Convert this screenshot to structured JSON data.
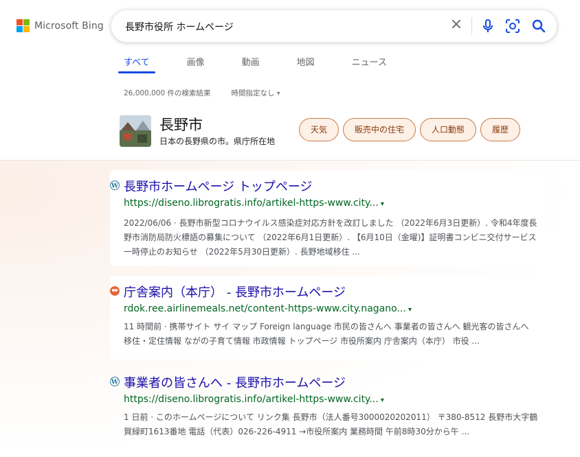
{
  "logo": {
    "text": "Microsoft Bing"
  },
  "search": {
    "query": "長野市役所 ホームページ"
  },
  "tabs": [
    {
      "label": "すべて"
    },
    {
      "label": "画像"
    },
    {
      "label": "動画"
    },
    {
      "label": "地図"
    },
    {
      "label": "ニュース"
    }
  ],
  "meta": {
    "result_count": "26,000,000 件の検索結果",
    "time_filter": "時間指定なし"
  },
  "entity": {
    "name": "長野市",
    "description": "日本の長野県の市。県庁所在地",
    "chips": [
      "天気",
      "販売中の住宅",
      "人口動態",
      "履歴"
    ]
  },
  "results": [
    {
      "title": "長野市ホームページ トップページ",
      "url": "https://diseno.librogratis.info/artikel-https-www.city...",
      "snippet": "2022/06/06 · 長野市新型コロナウイルス感染症対応方針を改訂しました （2022年6月3日更新）. 令和4年度長野市消防局防火標語の募集について （2022年6月1日更新）. 【6月10日（金曜)】証明書コンビニ交付サービス一時停止のお知らせ （2022年5月30日更新）. 長野地域移住 ..."
    },
    {
      "title": "庁舎案内（本庁） - 長野市ホームページ",
      "url": "rdok.ree.airlinemeals.net/content-https-www.city.nagano...",
      "snippet": "11 時間前 · 携帯サイト サイ マップ Foreign language 市民の皆さんへ 事業者の皆さんへ 観光客の皆さんへ 移住・定住情報 ながの子育て情報 市政情報 トップページ 市役所案内 庁舎案内（本庁） 市役 ..."
    },
    {
      "title": "事業者の皆さんへ - 長野市ホームページ",
      "url": "https://diseno.librogratis.info/artikel-https-www.city...",
      "snippet": "1 日前 · このホームページについて リンク集 長野市（法人番号3000020202011） 〒380-8512 長野市大字鶴賀緑町1613番地 電話（代表）026-226-4911 →市役所案内 業務時間 午前8時30分から午 ..."
    }
  ],
  "colors": {
    "accent": "#174ae4",
    "link": "#1a0dab",
    "url": "#006621",
    "chip_border": "#c87945",
    "chip_bg": "#fdf0e6"
  }
}
